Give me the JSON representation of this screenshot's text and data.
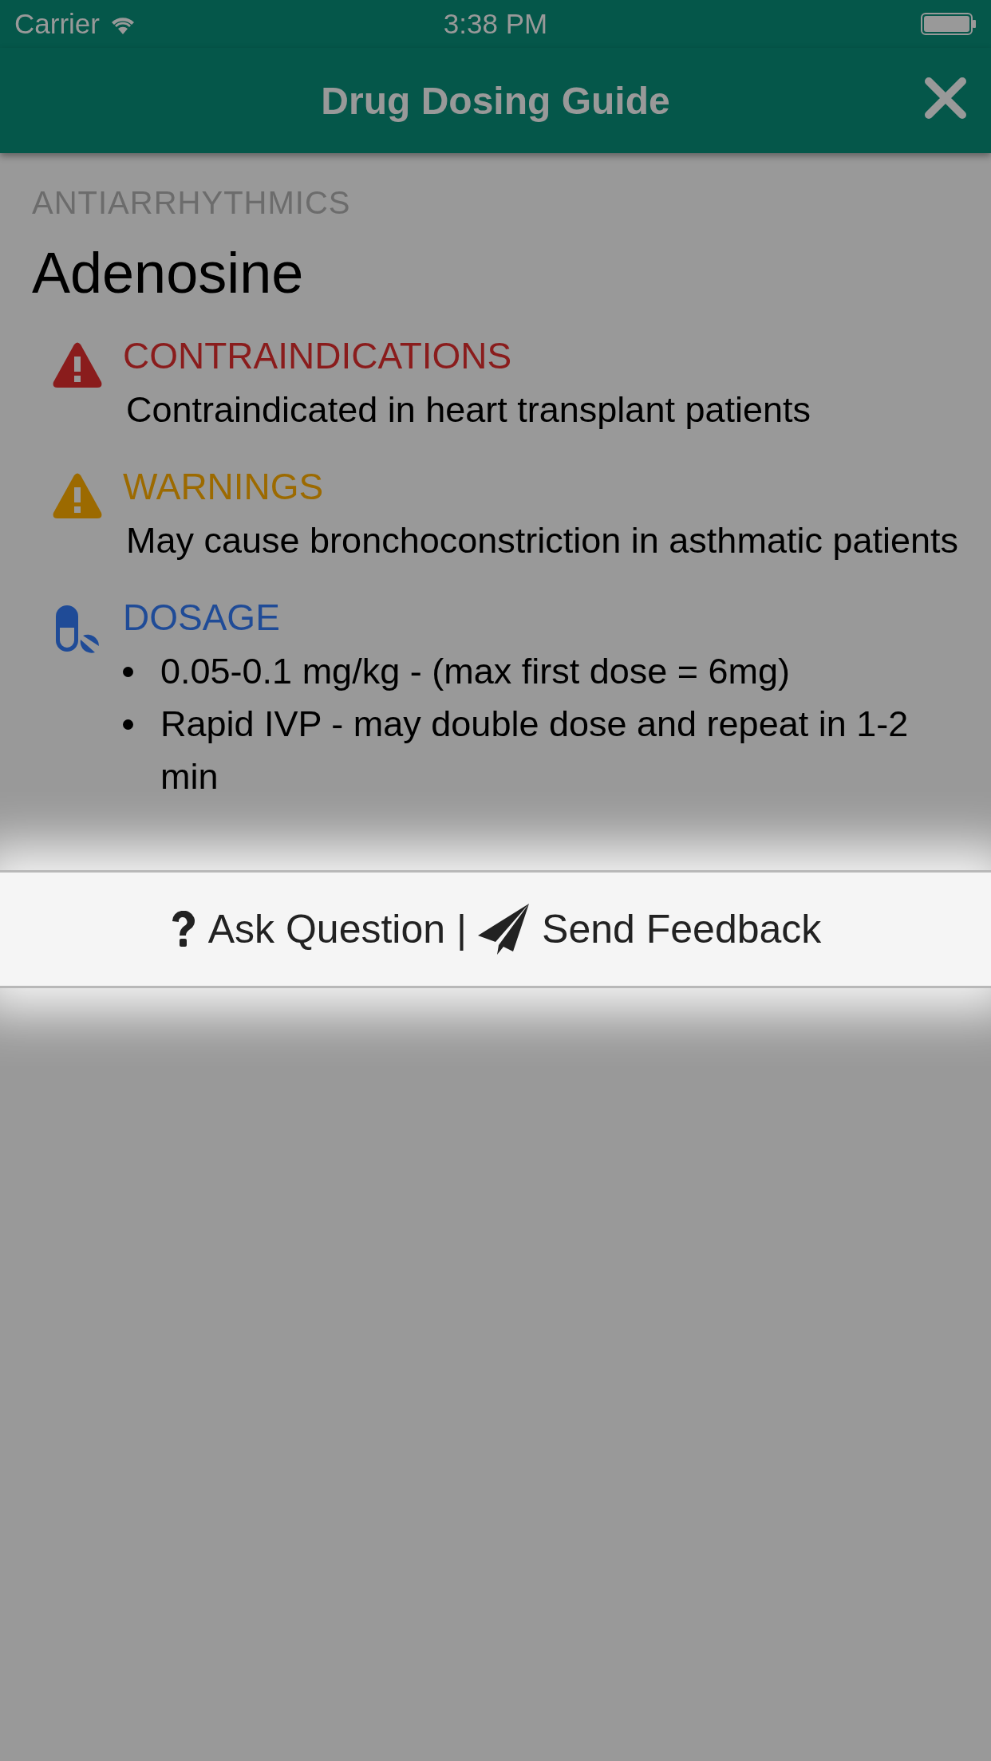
{
  "status_bar": {
    "carrier": "Carrier",
    "time": "3:38 PM"
  },
  "nav_bar": {
    "title": "Drug Dosing Guide"
  },
  "category": "ANTIARRHYTHMICS",
  "drug_name": "Adenosine",
  "sections": [
    {
      "kind": "contraindications",
      "title": "CONTRAINDICATIONS",
      "text": "Contraindicated in heart transplant patients"
    },
    {
      "kind": "warnings",
      "title": "WARNINGS",
      "text": "May cause bronchoconstriction in asthmatic patients"
    },
    {
      "kind": "dosage",
      "title": "DOSAGE",
      "items": [
        "0.05-0.1 mg/kg - (max first dose = 6mg)",
        "Rapid IVP - may double dose and repeat in 1-2 min"
      ]
    }
  ],
  "action_bar": {
    "actions": [
      {
        "kind": "question",
        "label": "Ask Question"
      },
      {
        "kind": "feedback",
        "label": "Send Feedback"
      }
    ],
    "separator": "|"
  }
}
